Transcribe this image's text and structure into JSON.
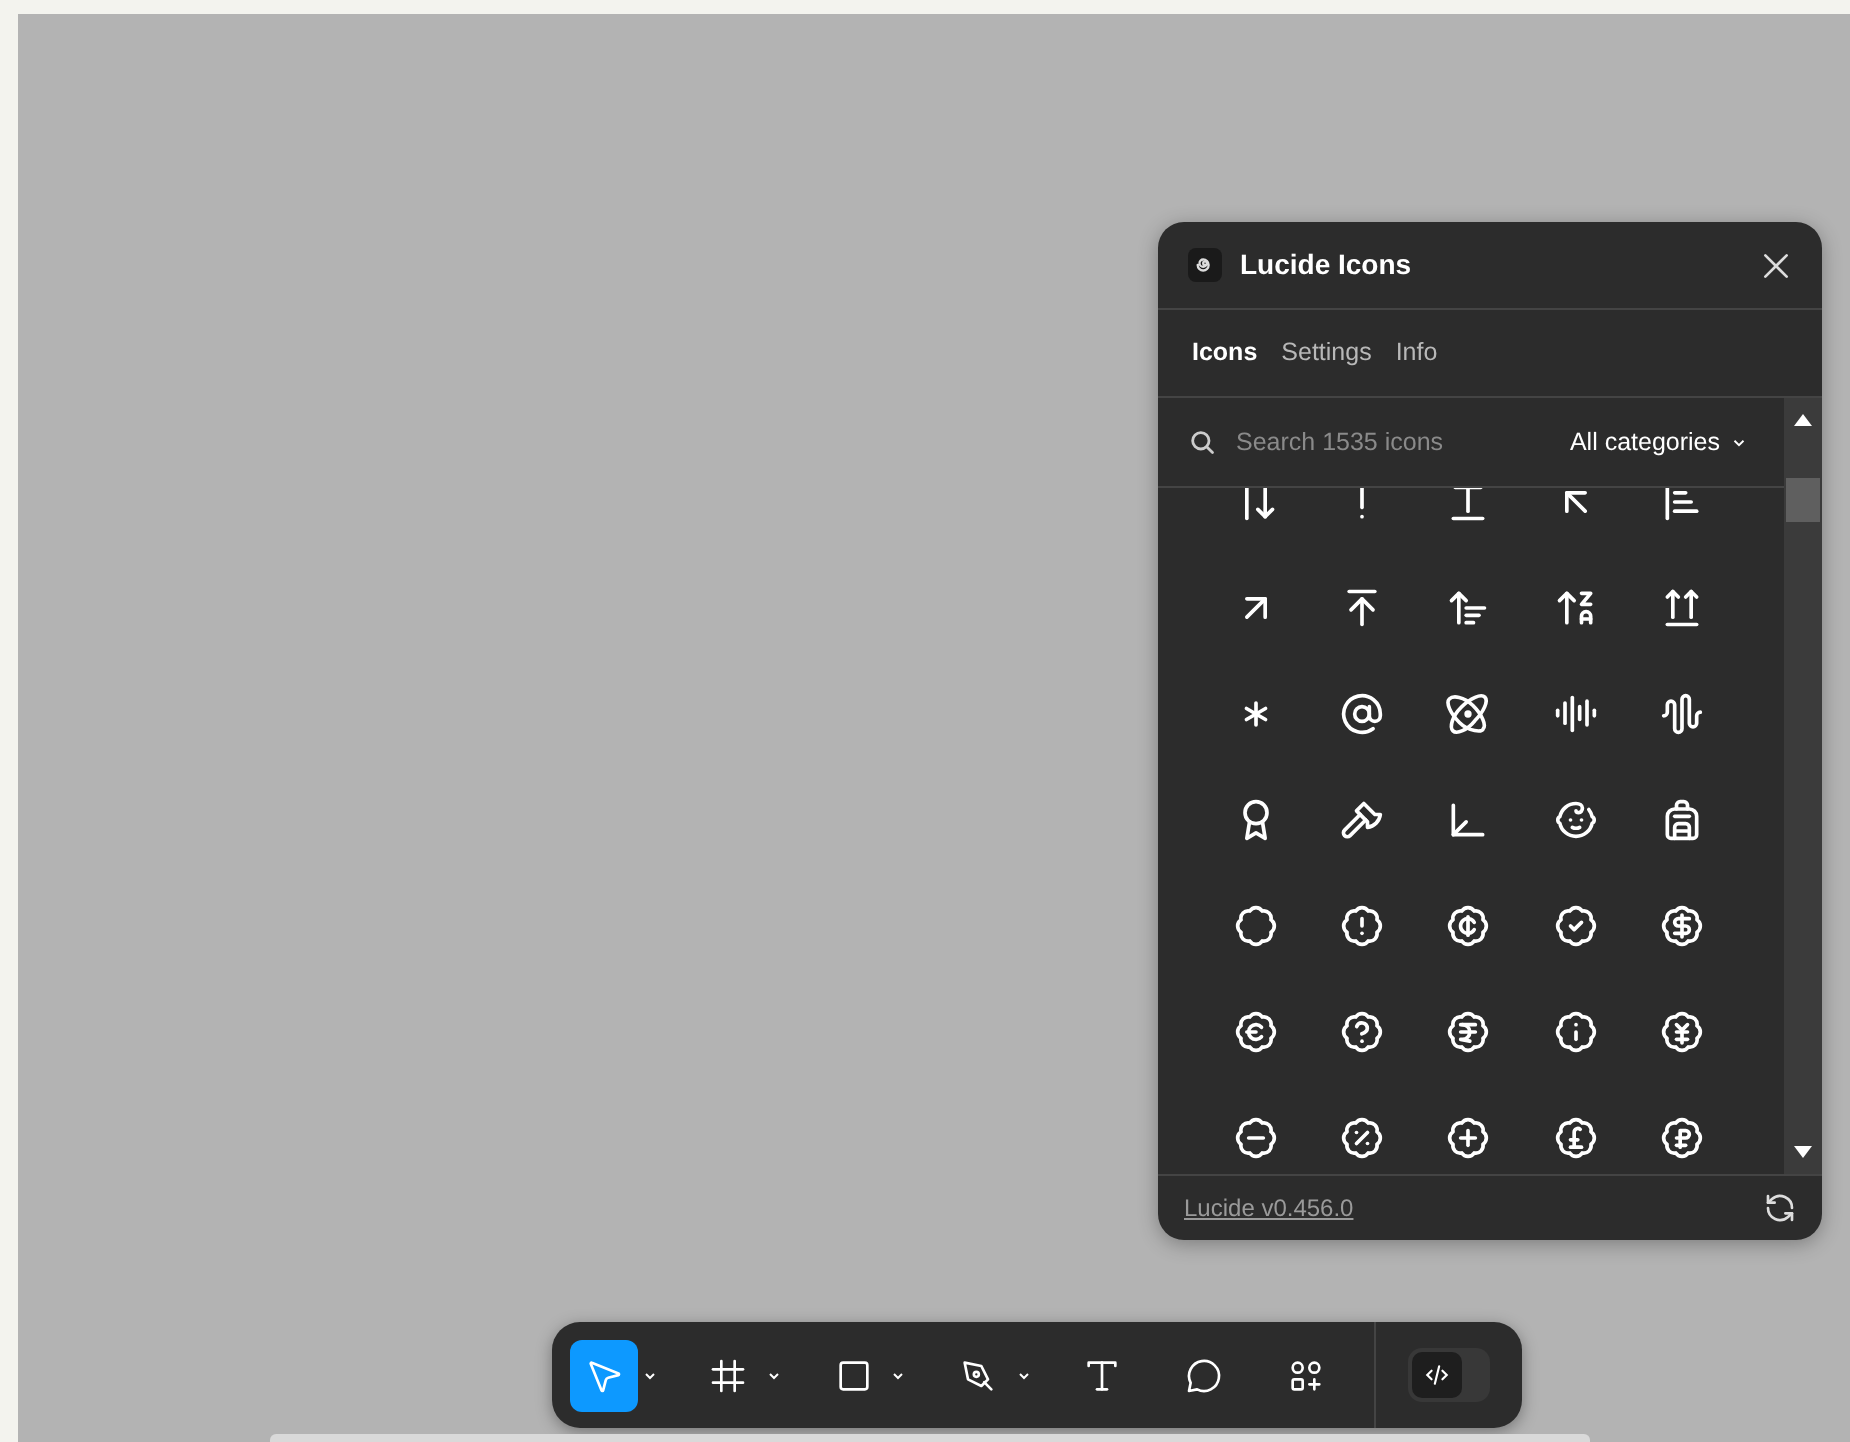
{
  "plugin": {
    "title": "Lucide Icons",
    "tabs": [
      {
        "label": "Icons",
        "selected": true
      },
      {
        "label": "Settings",
        "selected": false
      },
      {
        "label": "Info",
        "selected": false
      }
    ],
    "search": {
      "placeholder": "Search 1535 icons"
    },
    "category_filter": "All categories",
    "footer_link": "Lucide v0.456.0"
  },
  "toolbar": {
    "tools": [
      {
        "kind": "move",
        "selected": true,
        "dropdown": true
      },
      {
        "kind": "frame",
        "selected": false,
        "dropdown": true
      },
      {
        "kind": "shape",
        "selected": false,
        "dropdown": true
      },
      {
        "kind": "pen",
        "selected": false,
        "dropdown": true
      },
      {
        "kind": "text",
        "selected": false,
        "dropdown": false
      },
      {
        "kind": "comment",
        "selected": false,
        "dropdown": false
      },
      {
        "kind": "actions",
        "selected": false,
        "dropdown": false
      }
    ],
    "dev_mode": {
      "on": false
    }
  }
}
